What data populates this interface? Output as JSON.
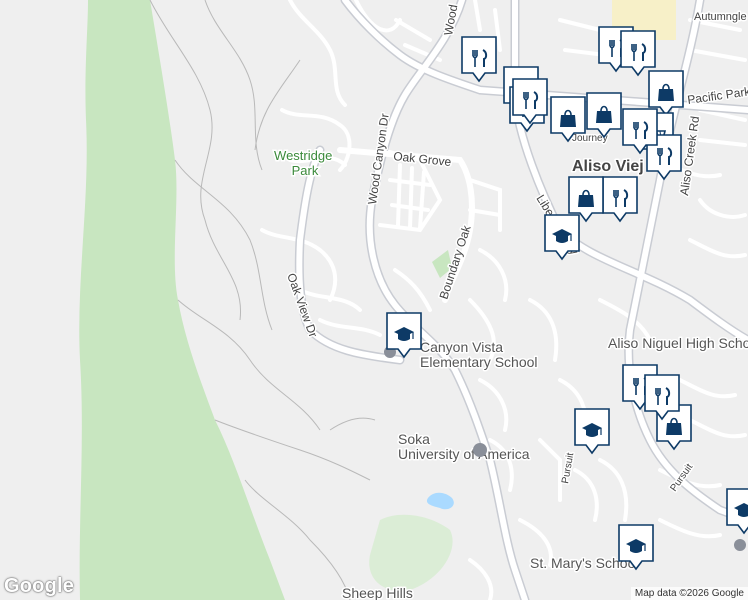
{
  "attribution": "Map data ©2026 Google",
  "logo": "Google",
  "colors": {
    "background": "#efefef",
    "park": "#c8e6c0",
    "road": "#ffffff",
    "road_edge": "#c9ccd3",
    "marker_fill": "#ffffff",
    "marker_border": "#0d3a66",
    "marker_icon": "#0d3a66"
  },
  "road_labels": {
    "wood_canyon_top": "Wood",
    "wood_canyon_dr": "Wood Canyon Dr",
    "oak_grove": "Oak Grove",
    "boundary_oak": "Boundary Oak",
    "oak_view_dr": "Oak View Dr",
    "liberty_pkwy": "Liberty Pkwy",
    "aliso_creek_rd": "Aliso Creek Rd",
    "pacific_park": "Pacific Park",
    "autumngle": "Autumngle",
    "pursuit_1": "Pursuit",
    "pursuit_2": "Pursuit",
    "journey": "Journey"
  },
  "place_labels": {
    "westridge_park": "Westridge Park",
    "aliso_viejo": "Aliso Viej",
    "canyon_vista": "Canyon Vista Elementary School",
    "soka": "Soka University of America",
    "aliso_niguel": "Aliso Niguel High Scho",
    "st_marys": "St. Mary's Schoo",
    "sheep_hills": "Sheep Hills"
  },
  "markers": [
    {
      "type": "restaurant",
      "icon": "fork-knife-icon"
    },
    {
      "type": "restaurant",
      "icon": "fork-knife-icon"
    },
    {
      "type": "restaurant",
      "icon": "fork-knife-icon"
    },
    {
      "type": "restaurant",
      "icon": "fork-knife-icon"
    },
    {
      "type": "shopping",
      "icon": "shopping-bag-icon"
    },
    {
      "type": "shopping",
      "icon": "shopping-bag-icon"
    },
    {
      "type": "restaurant",
      "icon": "fork-knife-icon"
    },
    {
      "type": "grocery",
      "icon": "shopping-cart-icon"
    },
    {
      "type": "restaurant",
      "icon": "fork-knife-icon"
    },
    {
      "type": "shopping",
      "icon": "shopping-bag-icon"
    },
    {
      "type": "restaurant",
      "icon": "fork-knife-icon"
    },
    {
      "type": "school",
      "icon": "graduation-cap-icon"
    },
    {
      "type": "school",
      "icon": "graduation-cap-icon"
    },
    {
      "type": "restaurant",
      "icon": "fork-knife-icon"
    },
    {
      "type": "restaurant",
      "icon": "fork-knife-icon"
    },
    {
      "type": "shopping",
      "icon": "shopping-bag-icon"
    },
    {
      "type": "school",
      "icon": "graduation-cap-icon"
    },
    {
      "type": "school",
      "icon": "graduation-cap-icon"
    },
    {
      "type": "school",
      "icon": "graduation-cap-icon"
    },
    {
      "type": "shopping",
      "icon": "shopping-bag-icon"
    },
    {
      "type": "restaurant",
      "icon": "fork-knife-icon"
    },
    {
      "type": "restaurant",
      "icon": "fork-knife-icon"
    }
  ]
}
